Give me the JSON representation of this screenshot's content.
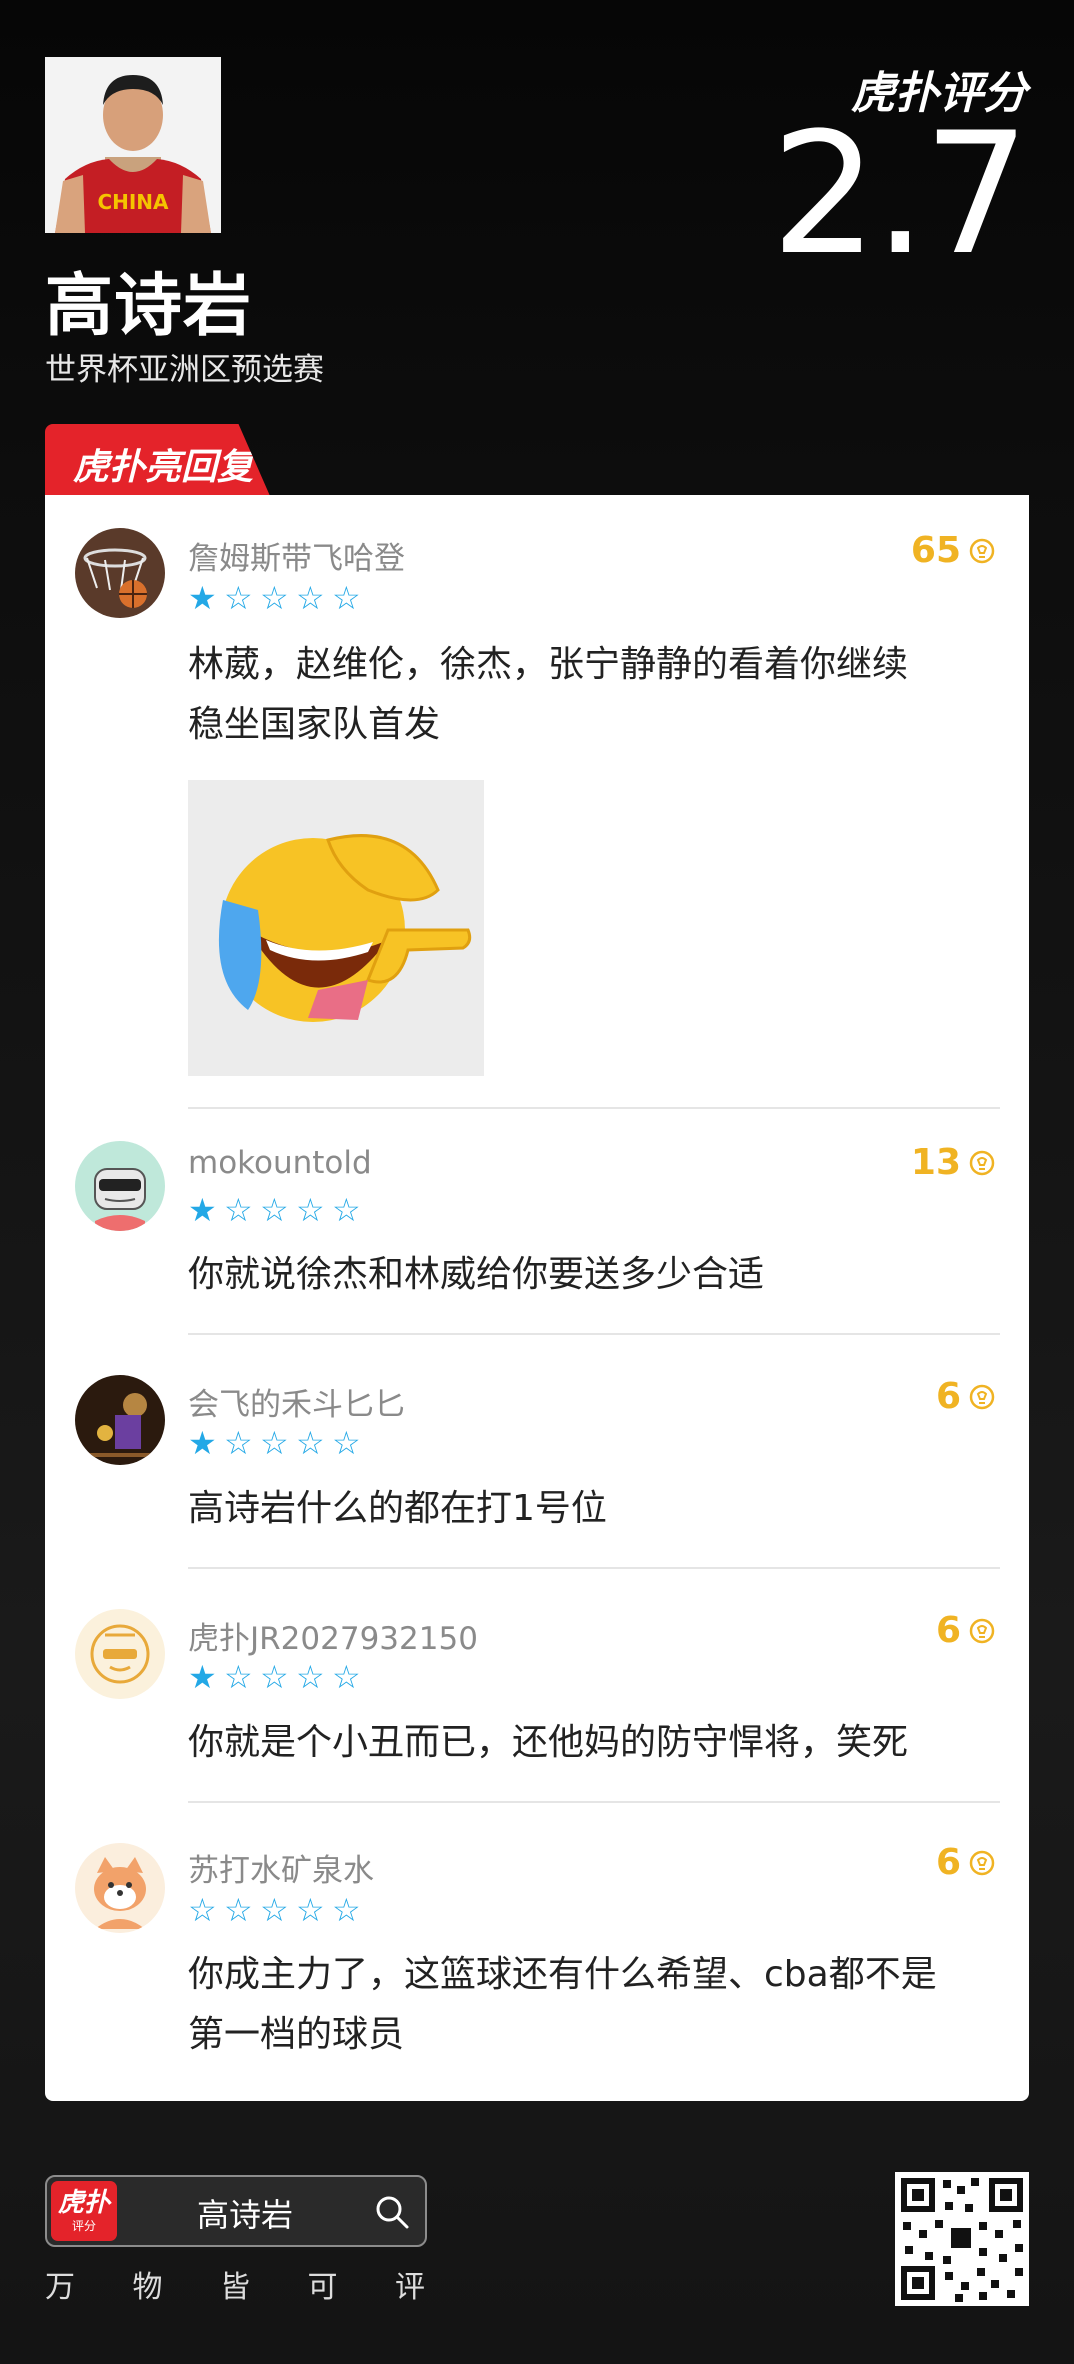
{
  "header": {
    "player_name": "高诗岩",
    "event": "世界杯亚洲区预选赛",
    "brand": "虎扑评分",
    "score": "2.7",
    "jersey_text": "CHINA"
  },
  "section": {
    "tab_label": "虎扑亮回复"
  },
  "comments": [
    {
      "user": "詹姆斯带飞哈登",
      "stars": 1,
      "likes": "65",
      "text_lines": [
        "林葳，赵维伦，徐杰，张宁静静的看着你继续",
        "稳坐国家队首发"
      ],
      "has_image": true,
      "image_icon": "facepalm-laugh-pointing-emoji",
      "avatar_icon": "basketball-hoop-avatar"
    },
    {
      "user": "mokountold",
      "stars": 1,
      "likes": "13",
      "text_lines": [
        "你就说徐杰和林威给你要送多少合适"
      ],
      "avatar_icon": "sunglasses-robot-avatar"
    },
    {
      "user": "会飞的禾斗匕匕",
      "stars": 1,
      "likes": "6",
      "text_lines": [
        "高诗岩什么的都在打1号位"
      ],
      "avatar_icon": "basketball-player-avatar"
    },
    {
      "user": "虎扑JR2027932150",
      "stars": 1,
      "likes": "6",
      "text_lines": [
        "你就是个小丑而已，还他妈的防守悍将，笑死"
      ],
      "avatar_icon": "default-hupu-avatar"
    },
    {
      "user": "苏打水矿泉水",
      "stars": 0,
      "likes": "6",
      "text_lines": [
        "你成主力了，这篮球还有什么希望、cba都不是",
        "第一档的球员"
      ],
      "avatar_icon": "shiba-dog-avatar"
    }
  ],
  "footer": {
    "search_logo_big": "虎扑",
    "search_logo_small": "评分",
    "search_text": "高诗岩",
    "slogan": [
      "万",
      "物",
      "皆",
      "可",
      "评"
    ]
  },
  "colors": {
    "accent_red": "#e4232a",
    "star_blue": "#23a8e6",
    "like_gold": "#f0b323"
  }
}
